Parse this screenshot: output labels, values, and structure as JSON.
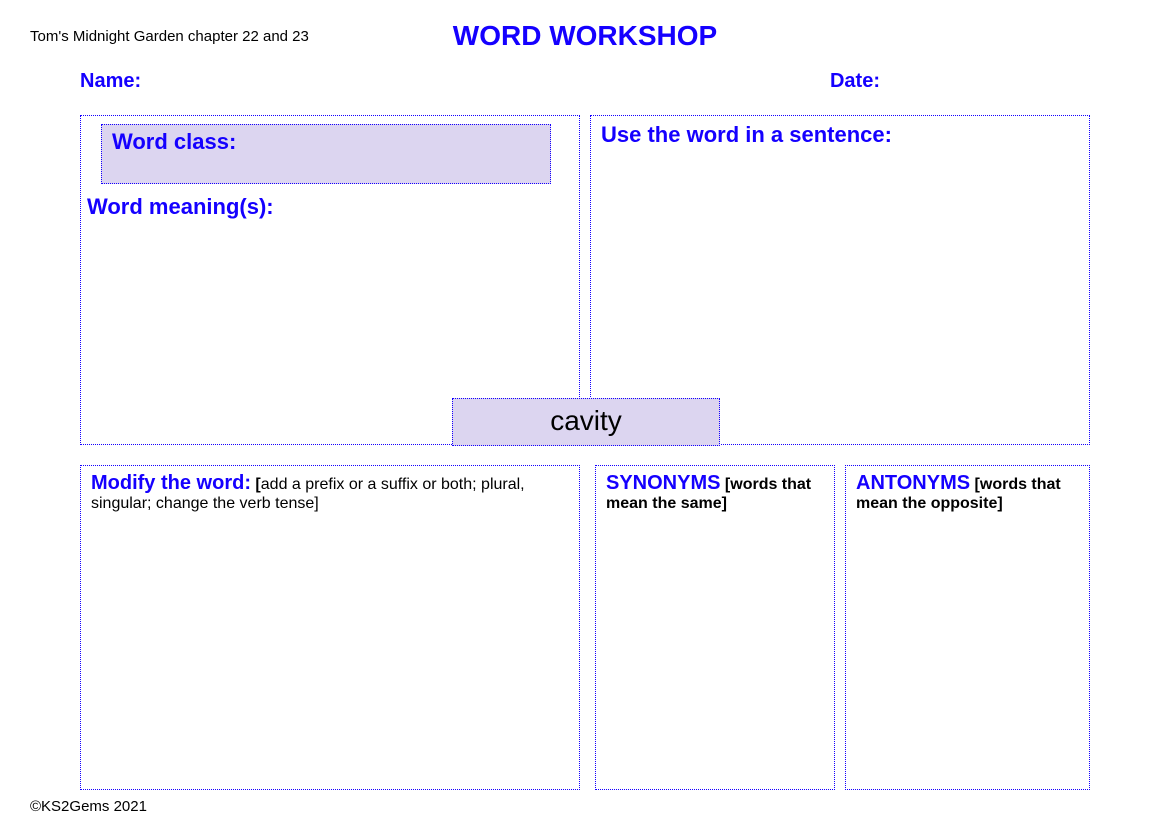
{
  "header": {
    "chapter": "Tom's Midnight Garden chapter 22 and 23",
    "title": "WORD WORKSHOP",
    "name_label": "Name:",
    "date_label": "Date:"
  },
  "target_word": "cavity",
  "boxes": {
    "word_class": "Word class:",
    "word_meanings": "Word meaning(s):",
    "sentence": "Use the word in a sentence:",
    "modify_label": "Modify the word:",
    "modify_hint_open": " [",
    "modify_hint": "add a prefix or a suffix or both; plural, singular; change the verb tense]",
    "synonyms_label": "SYNONYMS",
    "synonyms_hint": " [words that mean the same]",
    "antonyms_label": "ANTONYMS",
    "antonyms_hint": " [words that mean the opposite]"
  },
  "footer": {
    "copyright": "©KS2Gems 2021"
  }
}
